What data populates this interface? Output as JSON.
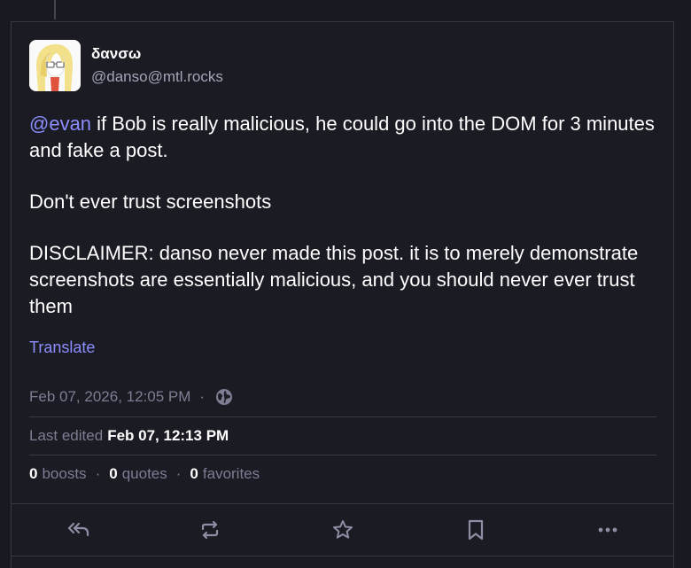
{
  "author": {
    "display_name": "δανσω",
    "handle": "@danso@mtl.rocks"
  },
  "post": {
    "mention": "@evan",
    "paragraph1_rest": " if Bob is really malicious, he could go into the DOM for 3 minutes and fake a post.",
    "paragraph2": "Don't ever trust screenshots",
    "paragraph3": "DISCLAIMER: danso never made this post. it is to merely demonstrate screenshots are essentially malicious, and you should never ever trust them"
  },
  "translate_label": "Translate",
  "meta": {
    "date": "Feb 07, 2026, 12:05 PM",
    "date_separator": "·",
    "visibility_icon": "globe-icon",
    "edited_label": "Last edited",
    "edited_date": "Feb 07, 12:13 PM"
  },
  "counts": {
    "boosts_value": "0",
    "boosts_label": "boosts",
    "quotes_value": "0",
    "quotes_label": "quotes",
    "favorites_value": "0",
    "favorites_label": "favorites",
    "separator": "·"
  },
  "actions": {
    "reply_icon": "reply-all-icon",
    "boost_icon": "boost-icon",
    "favorite_icon": "star-icon",
    "bookmark_icon": "bookmark-icon",
    "more_icon": "more-icon"
  },
  "colors": {
    "background": "#191921",
    "accent": "#8c8dff",
    "muted": "#7d7d93",
    "border": "#393946"
  }
}
